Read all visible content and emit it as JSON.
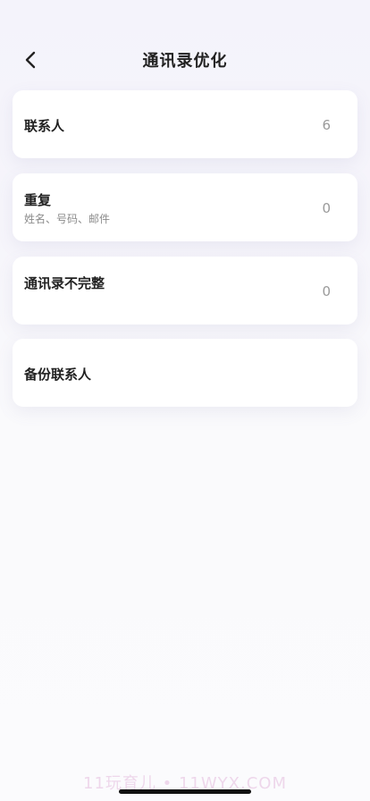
{
  "header": {
    "title": "通讯录优化",
    "back_icon": "chevron-left-icon"
  },
  "cards": [
    {
      "title": "联系人",
      "subtitle": "",
      "count": "6"
    },
    {
      "title": "重复",
      "subtitle": "姓名、号码、邮件",
      "count": "0"
    },
    {
      "title": "通讯录不完整",
      "subtitle": "",
      "count": "0"
    },
    {
      "title": "备份联系人",
      "subtitle": "",
      "count": ""
    }
  ],
  "watermark": "11玩育儿 • 11WYX.COM",
  "colors": {
    "background": "#f6f5fb",
    "card": "#ffffff",
    "count_text": "#9a9a9a"
  }
}
